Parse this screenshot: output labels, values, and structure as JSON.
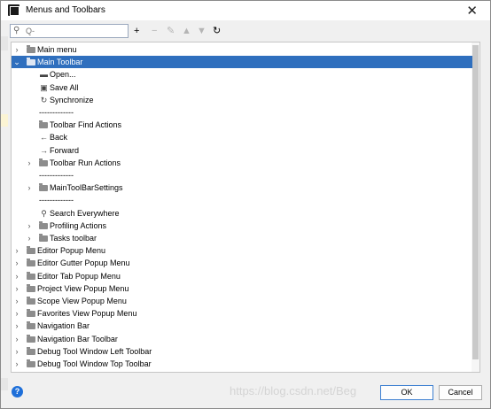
{
  "window": {
    "title": "Menus and Toolbars",
    "close_glyph": "✕"
  },
  "search": {
    "placeholder": "Q-",
    "value": ""
  },
  "toolbar": [
    {
      "name": "add-button",
      "glyph": "+",
      "enabled": true
    },
    {
      "name": "remove-button",
      "glyph": "−",
      "enabled": false
    },
    {
      "name": "edit-button",
      "glyph": "✎",
      "enabled": false
    },
    {
      "name": "move-up-button",
      "glyph": "▲",
      "enabled": false
    },
    {
      "name": "move-down-button",
      "glyph": "▼",
      "enabled": false
    },
    {
      "name": "restore-button",
      "glyph": "↻",
      "enabled": true
    }
  ],
  "tree": {
    "items": [
      {
        "label": "Main menu",
        "level": 0,
        "type": "folder",
        "expander": "collapsed"
      },
      {
        "label": "Main Toolbar",
        "level": 0,
        "type": "folder",
        "expander": "expanded",
        "selected": true
      },
      {
        "label": "Open...",
        "level": 1,
        "type": "action",
        "icon": "folder-open-icon",
        "glyph": "▬"
      },
      {
        "label": "Save All",
        "level": 1,
        "type": "action",
        "icon": "save-icon",
        "glyph": "▣"
      },
      {
        "label": "Synchronize",
        "level": 1,
        "type": "action",
        "icon": "synchronize-icon",
        "glyph": "↻"
      },
      {
        "label": "-------------",
        "level": 1,
        "type": "separator"
      },
      {
        "label": "Toolbar Find Actions",
        "level": 1,
        "type": "folder"
      },
      {
        "label": "Back",
        "level": 1,
        "type": "action",
        "icon": "back-arrow-icon",
        "glyph": "←"
      },
      {
        "label": "Forward",
        "level": 1,
        "type": "action",
        "icon": "forward-arrow-icon",
        "glyph": "→"
      },
      {
        "label": "Toolbar Run Actions",
        "level": 1,
        "type": "folder",
        "expander": "collapsed"
      },
      {
        "label": "-------------",
        "level": 1,
        "type": "separator"
      },
      {
        "label": "MainToolBarSettings",
        "level": 1,
        "type": "folder",
        "expander": "collapsed"
      },
      {
        "label": "-------------",
        "level": 1,
        "type": "separator"
      },
      {
        "label": "Search Everywhere",
        "level": 1,
        "type": "action",
        "icon": "search-icon",
        "glyph": "⚲"
      },
      {
        "label": "Profiling Actions",
        "level": 1,
        "type": "folder",
        "expander": "collapsed"
      },
      {
        "label": "Tasks toolbar",
        "level": 1,
        "type": "folder",
        "expander": "collapsed"
      },
      {
        "label": "Editor Popup Menu",
        "level": 0,
        "type": "folder",
        "expander": "collapsed"
      },
      {
        "label": "Editor Gutter Popup Menu",
        "level": 0,
        "type": "folder",
        "expander": "collapsed"
      },
      {
        "label": "Editor Tab Popup Menu",
        "level": 0,
        "type": "folder",
        "expander": "collapsed"
      },
      {
        "label": "Project View Popup Menu",
        "level": 0,
        "type": "folder",
        "expander": "collapsed"
      },
      {
        "label": "Scope View Popup Menu",
        "level": 0,
        "type": "folder",
        "expander": "collapsed"
      },
      {
        "label": "Favorites View Popup Menu",
        "level": 0,
        "type": "folder",
        "expander": "collapsed"
      },
      {
        "label": "Navigation Bar",
        "level": 0,
        "type": "folder",
        "expander": "collapsed"
      },
      {
        "label": "Navigation Bar Toolbar",
        "level": 0,
        "type": "folder",
        "expander": "collapsed"
      },
      {
        "label": "Debug Tool Window Left Toolbar",
        "level": 0,
        "type": "folder",
        "expander": "collapsed"
      },
      {
        "label": "Debug Tool Window Top Toolbar",
        "level": 0,
        "type": "folder",
        "expander": "collapsed"
      }
    ]
  },
  "footer": {
    "help_glyph": "?",
    "watermark": "https://blog.csdn.net/Beg",
    "ok_label": "OK",
    "cancel_label": "Cancel"
  },
  "colors": {
    "selection": "#2f6fbe",
    "annotation_arrow": "#e8302a",
    "help": "#1e6fd9"
  }
}
